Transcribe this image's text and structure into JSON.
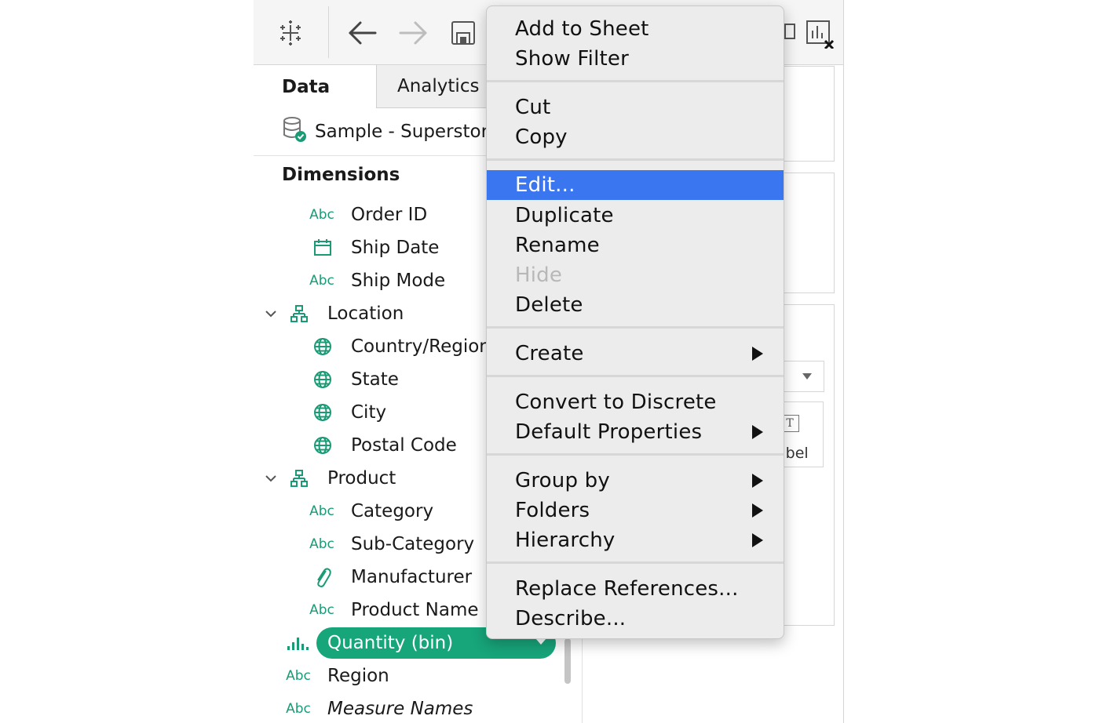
{
  "tabs": {
    "data": "Data",
    "analytics": "Analytics"
  },
  "datasource": {
    "name": "Sample - Superstore",
    "icon": "database-check-icon"
  },
  "dimensions_title": "Dimensions",
  "fields": {
    "order_id": "Order ID",
    "ship_date": "Ship Date",
    "ship_mode": "Ship Mode",
    "location": "Location",
    "country": "Country/Region",
    "state": "State",
    "city": "City",
    "postal": "Postal Code",
    "product": "Product",
    "category": "Category",
    "subcategory": "Sub-Category",
    "manufacturer": "Manufacturer",
    "product_name": "Product Name",
    "quantity_bin": "Quantity (bin)",
    "region": "Region",
    "measure_names": "Measure Names"
  },
  "type_abbrev": "Abc",
  "right_label": "abel",
  "right_label_glyph": "T",
  "menu": {
    "add_to_sheet": "Add to Sheet",
    "show_filter": "Show Filter",
    "cut": "Cut",
    "copy": "Copy",
    "edit": "Edit...",
    "duplicate": "Duplicate",
    "rename": "Rename",
    "hide": "Hide",
    "delete": "Delete",
    "create": "Create",
    "convert": "Convert to Discrete",
    "default_props": "Default Properties",
    "group_by": "Group by",
    "folders": "Folders",
    "hierarchy": "Hierarchy",
    "replace_refs": "Replace References...",
    "describe": "Describe..."
  },
  "colors": {
    "accent_green": "#17a57a",
    "menu_highlight": "#3b76f1"
  }
}
